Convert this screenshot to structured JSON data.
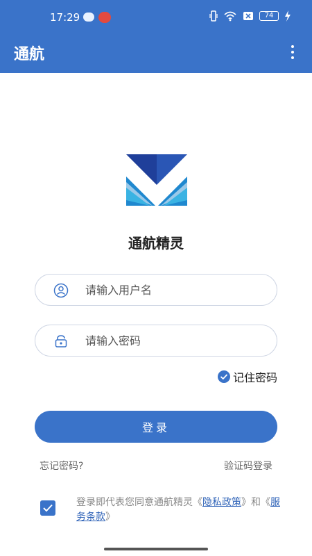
{
  "status": {
    "time": "17:29",
    "battery": "74"
  },
  "app_bar": {
    "title": "通航"
  },
  "brand": {
    "name": "通航精灵"
  },
  "form": {
    "username_placeholder": "请输入用户名",
    "password_placeholder": "请输入密码",
    "remember_label": "记住密码",
    "login_label": "登录"
  },
  "links": {
    "forgot": "忘记密码?",
    "code_login": "验证码登录"
  },
  "agreement": {
    "prefix": "登录即代表您同意通航精灵《",
    "privacy": "隐私政策",
    "middle": "》和《",
    "terms": "服务条款",
    "suffix": "》"
  },
  "colors": {
    "primary": "#3a73c9",
    "logo_dark": "#1f3f9a",
    "logo_light": "#2aa5dc"
  }
}
